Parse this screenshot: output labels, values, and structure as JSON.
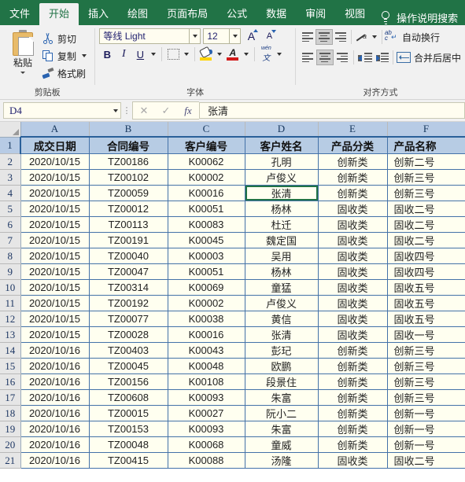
{
  "app": {
    "ribbon_tabs": [
      {
        "label": "文件",
        "active": false
      },
      {
        "label": "开始",
        "active": true
      },
      {
        "label": "插入",
        "active": false
      },
      {
        "label": "绘图",
        "active": false
      },
      {
        "label": "页面布局",
        "active": false
      },
      {
        "label": "公式",
        "active": false
      },
      {
        "label": "数据",
        "active": false
      },
      {
        "label": "审阅",
        "active": false
      },
      {
        "label": "视图",
        "active": false
      }
    ],
    "tell_me": "操作说明搜索",
    "accent_color": "#217346"
  },
  "ribbon": {
    "clipboard": {
      "group_label": "剪贴板",
      "paste_label": "粘贴",
      "cut_label": "剪切",
      "copy_label": "复制",
      "format_painter_label": "格式刷"
    },
    "font": {
      "group_label": "字体",
      "font_name": "等线 Light",
      "font_size": "12",
      "bold": "B",
      "italic": "I",
      "underline": "U",
      "grow_font": "A",
      "shrink_font": "A",
      "phonetic_top": "wén",
      "phonetic_bottom": "文"
    },
    "alignment": {
      "group_label": "对齐方式",
      "wrap_text_label": "自动换行",
      "merge_center_label": "合并后居中",
      "orientation_letter": "a",
      "wrap_ab": "ab",
      "wrap_c": "c"
    }
  },
  "formula_bar": {
    "name_box": "D4",
    "cancel": "✕",
    "confirm": "✓",
    "fx": "fx",
    "content": "张清"
  },
  "sheet": {
    "columns": [
      "A",
      "B",
      "C",
      "D",
      "E",
      "F"
    ],
    "selected_columns": [
      "A",
      "B",
      "C",
      "D",
      "E",
      "F"
    ],
    "active_cell": {
      "row": 4,
      "col": "D"
    },
    "rows": [
      {
        "n": "1",
        "cells": [
          "成交日期",
          "合同编号",
          "客户编号",
          "客户姓名",
          "产品分类",
          "产品名称"
        ],
        "header": true
      },
      {
        "n": "2",
        "cells": [
          "2020/10/15",
          "TZ00186",
          "K00062",
          "孔明",
          "创新类",
          "创新二号"
        ]
      },
      {
        "n": "3",
        "cells": [
          "2020/10/15",
          "TZ00102",
          "K00002",
          "卢俊义",
          "创新类",
          "创新三号"
        ]
      },
      {
        "n": "4",
        "cells": [
          "2020/10/15",
          "TZ00059",
          "K00016",
          "张清",
          "创新类",
          "创新三号"
        ]
      },
      {
        "n": "5",
        "cells": [
          "2020/10/15",
          "TZ00012",
          "K00051",
          "杨林",
          "固收类",
          "固收二号"
        ]
      },
      {
        "n": "6",
        "cells": [
          "2020/10/15",
          "TZ00113",
          "K00083",
          "杜迁",
          "固收类",
          "固收二号"
        ]
      },
      {
        "n": "7",
        "cells": [
          "2020/10/15",
          "TZ00191",
          "K00045",
          "魏定国",
          "固收类",
          "固收二号"
        ]
      },
      {
        "n": "8",
        "cells": [
          "2020/10/15",
          "TZ00040",
          "K00003",
          "吴用",
          "固收类",
          "固收四号"
        ]
      },
      {
        "n": "9",
        "cells": [
          "2020/10/15",
          "TZ00047",
          "K00051",
          "杨林",
          "固收类",
          "固收四号"
        ]
      },
      {
        "n": "10",
        "cells": [
          "2020/10/15",
          "TZ00314",
          "K00069",
          "童猛",
          "固收类",
          "固收五号"
        ]
      },
      {
        "n": "11",
        "cells": [
          "2020/10/15",
          "TZ00192",
          "K00002",
          "卢俊义",
          "固收类",
          "固收五号"
        ]
      },
      {
        "n": "12",
        "cells": [
          "2020/10/15",
          "TZ00077",
          "K00038",
          "黄信",
          "固收类",
          "固收五号"
        ]
      },
      {
        "n": "13",
        "cells": [
          "2020/10/15",
          "TZ00028",
          "K00016",
          "张清",
          "固收类",
          "固收一号"
        ]
      },
      {
        "n": "14",
        "cells": [
          "2020/10/16",
          "TZ00403",
          "K00043",
          "彭玘",
          "创新类",
          "创新三号"
        ]
      },
      {
        "n": "15",
        "cells": [
          "2020/10/16",
          "TZ00045",
          "K00048",
          "欧鹏",
          "创新类",
          "创新三号"
        ]
      },
      {
        "n": "16",
        "cells": [
          "2020/10/16",
          "TZ00156",
          "K00108",
          "段景住",
          "创新类",
          "创新三号"
        ]
      },
      {
        "n": "17",
        "cells": [
          "2020/10/16",
          "TZ00608",
          "K00093",
          "朱富",
          "创新类",
          "创新三号"
        ]
      },
      {
        "n": "18",
        "cells": [
          "2020/10/16",
          "TZ00015",
          "K00027",
          "阮小二",
          "创新类",
          "创新一号"
        ]
      },
      {
        "n": "19",
        "cells": [
          "2020/10/16",
          "TZ00153",
          "K00093",
          "朱富",
          "创新类",
          "创新一号"
        ]
      },
      {
        "n": "20",
        "cells": [
          "2020/10/16",
          "TZ00048",
          "K00068",
          "童威",
          "创新类",
          "创新一号"
        ]
      },
      {
        "n": "21",
        "cells": [
          "2020/10/16",
          "TZ00415",
          "K00088",
          "汤隆",
          "固收类",
          "固收二号"
        ]
      }
    ]
  }
}
